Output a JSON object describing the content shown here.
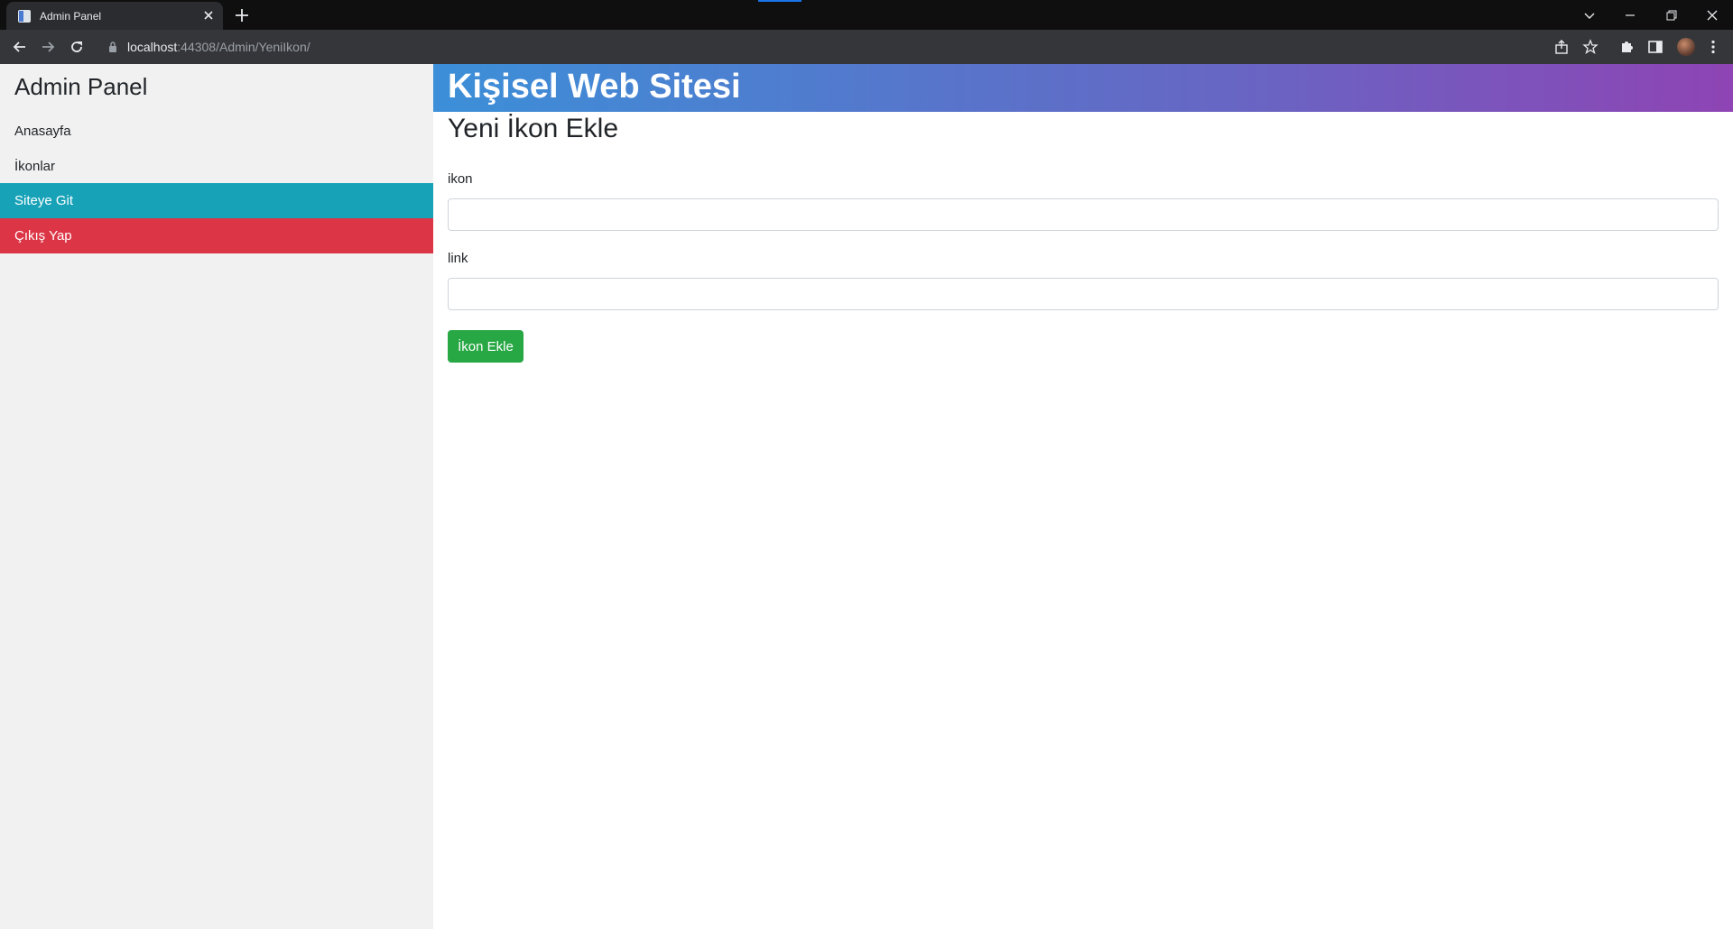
{
  "browser": {
    "tab_title": "Admin Panel",
    "url_host": "localhost",
    "url_rest": ":44308/Admin/YeniIkon/"
  },
  "sidebar": {
    "title": "Admin Panel",
    "items": [
      {
        "label": "Anasayfa"
      },
      {
        "label": "İkonlar"
      },
      {
        "label": "Siteye Git"
      },
      {
        "label": "Çıkış Yap"
      }
    ]
  },
  "header": {
    "title": "Kişisel Web Sitesi"
  },
  "main": {
    "page_title": "Yeni İkon Ekle",
    "fields": [
      {
        "label": "ikon",
        "value": ""
      },
      {
        "label": "link",
        "value": ""
      }
    ],
    "submit_label": "İkon Ekle"
  },
  "colors": {
    "sidebar_active": "#17a2b8",
    "sidebar_logout": "#dc3545",
    "submit": "#28a745",
    "header_gradient_start": "#3c8fd8",
    "header_gradient_end": "#8e44b4"
  }
}
